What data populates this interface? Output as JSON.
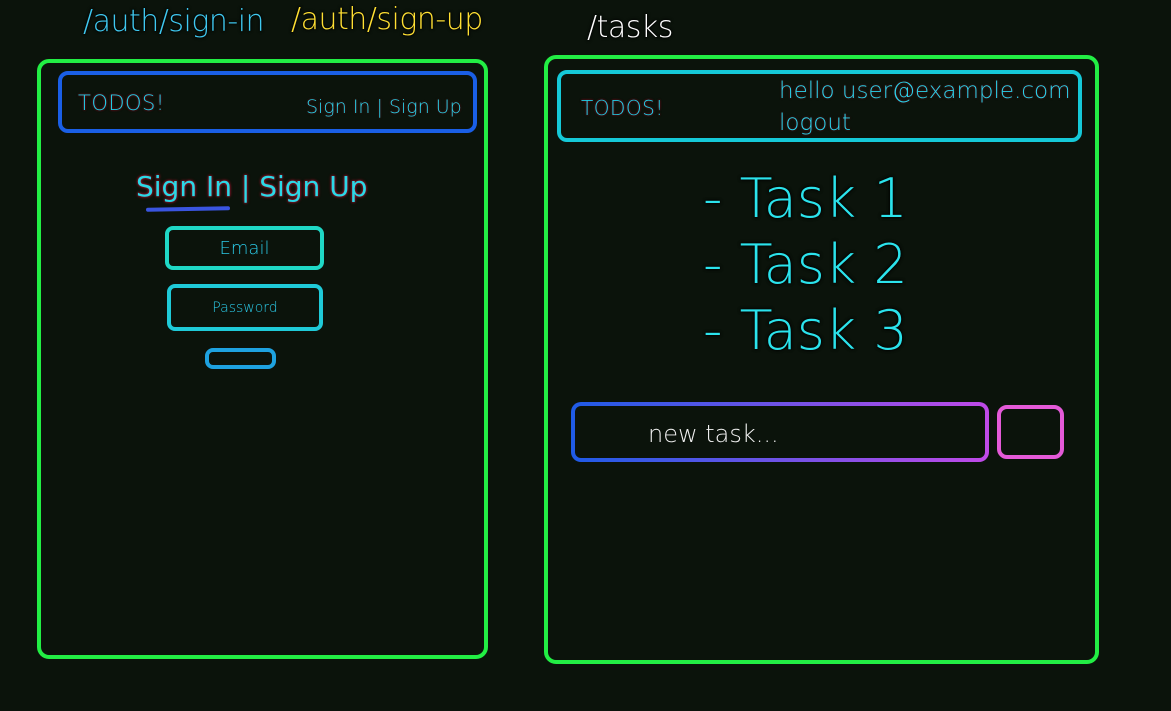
{
  "routes": {
    "sign_in": "/auth/sign-in",
    "sign_up": "/auth/sign-up",
    "tasks": "/tasks"
  },
  "auth_page": {
    "brand": "TODOS!",
    "nav_links": "Sign In | Sign Up",
    "tab_sign_in": "Sign In",
    "tab_separator": " | ",
    "tab_sign_up": "Sign Up",
    "email_placeholder": "Email",
    "password_placeholder": "Password"
  },
  "tasks_page": {
    "brand": "TODOS!",
    "greeting": "hello user@example.com",
    "logout": "logout",
    "tasks": [
      "- Task 1",
      "- Task 2",
      "- Task 3"
    ],
    "new_task_placeholder": "new task..."
  },
  "colors": {
    "background": "#0b130b",
    "frame": "#22ee44",
    "route_sign_in": "#3fc9f0",
    "route_sign_up": "#ffe033",
    "route_tasks": "#ffffff",
    "navbar": "#1a5fe6",
    "accent_cyan": "#2be3ec",
    "input_border_start": "#1f5be6",
    "input_border_end": "#c04ae8",
    "add_button": "#e45ad8"
  }
}
